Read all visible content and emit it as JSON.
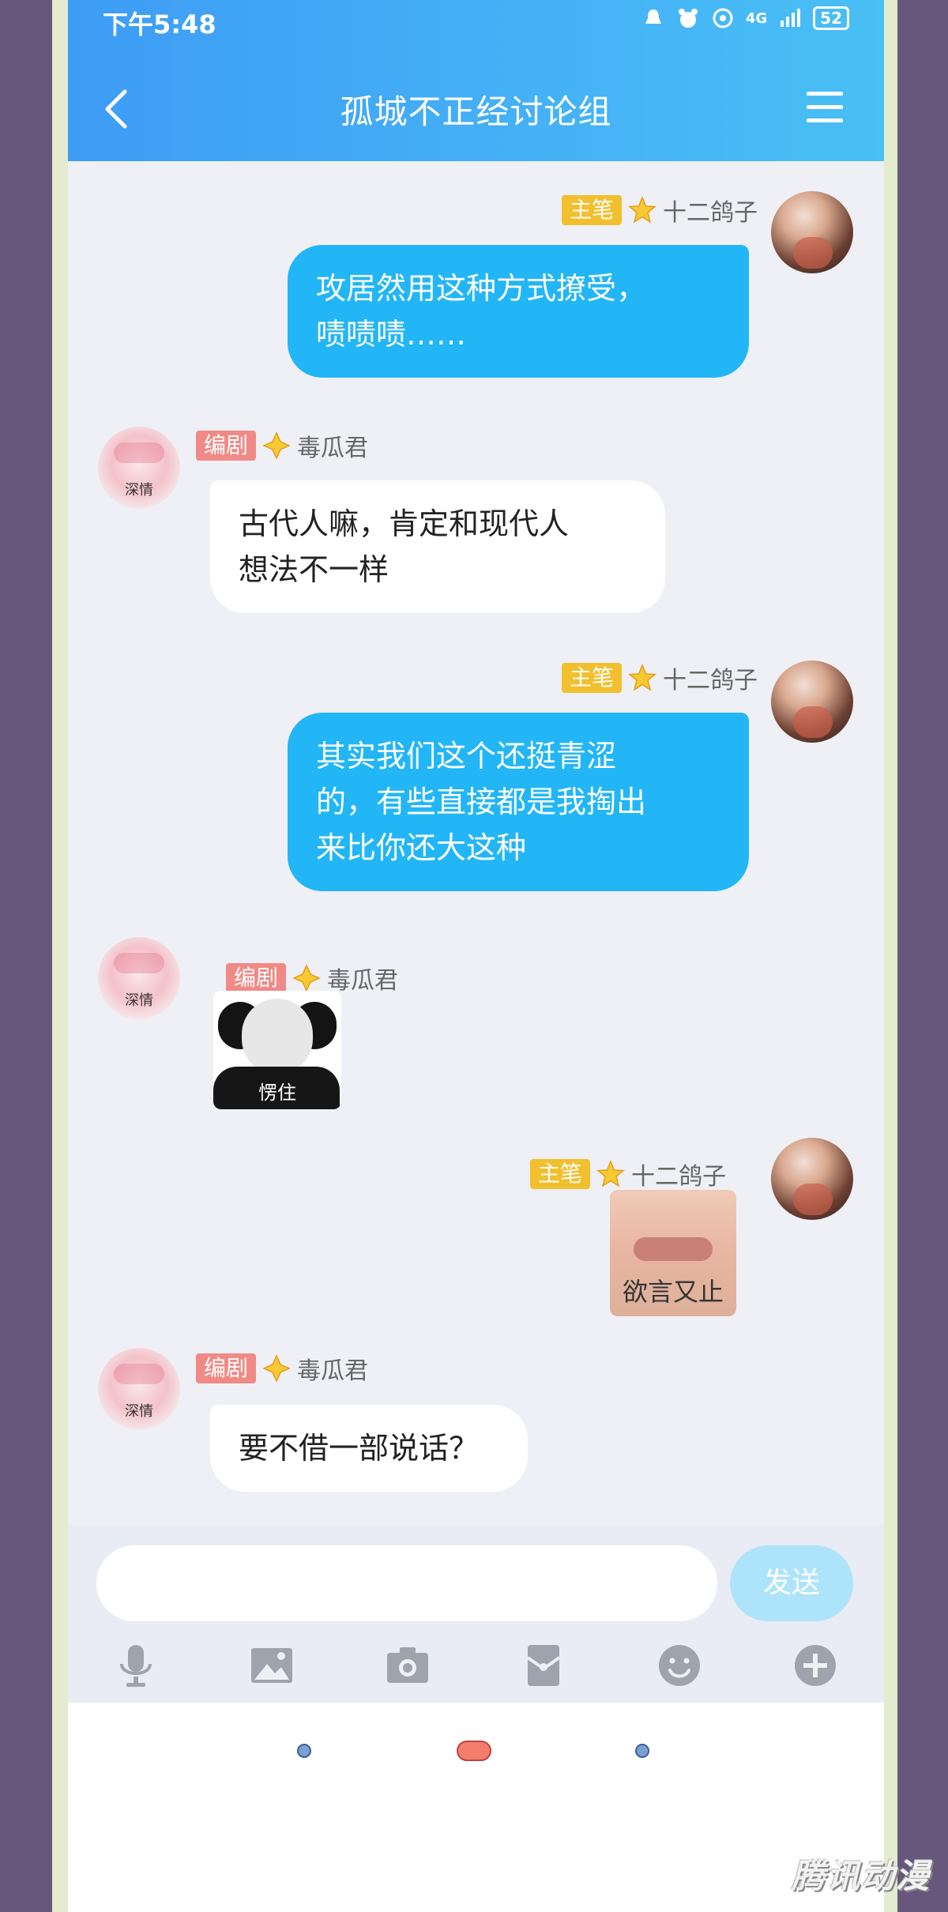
{
  "status": {
    "time": "下午5:48",
    "network": "4G",
    "battery": "52"
  },
  "header": {
    "title": "孤城不正经讨论组"
  },
  "messages": [
    {
      "side": "right",
      "role": "主笔",
      "name": "十二鸽子",
      "text_lines": [
        "攻居然用这种方式撩受，",
        "啧啧啧……"
      ]
    },
    {
      "side": "left",
      "role": "编剧",
      "name": "毒瓜君",
      "avatar_text": "深情",
      "text_lines": [
        "古代人嘛，肯定和现代人",
        "想法不一样"
      ]
    },
    {
      "side": "right",
      "role": "主笔",
      "name": "十二鸽子",
      "text_lines": [
        "其实我们这个还挺青涩",
        "的，有些直接都是我掏出",
        "来比你还大这种"
      ]
    },
    {
      "side": "left",
      "role": "编剧",
      "name": "毒瓜君",
      "avatar_text": "深情",
      "sticker_text": "愣住"
    },
    {
      "side": "right",
      "role": "主笔",
      "name": "十二鸽子",
      "sticker_text": "欲言又止"
    },
    {
      "side": "left",
      "role": "编剧",
      "name": "毒瓜君",
      "avatar_text": "深情",
      "text_lines": [
        "要不借一部说话？"
      ]
    }
  ],
  "input": {
    "placeholder": "",
    "send_label": "发送"
  },
  "toolbar": [
    "microphone-icon",
    "image-icon",
    "camera-icon",
    "red-packet-icon",
    "emoji-icon",
    "plus-icon"
  ],
  "watermark": "腾讯动漫",
  "colors": {
    "header": "#45b2f6",
    "bubble_right": "#22b6f6",
    "badge_main": "#f2bf2e",
    "badge_writer": "#ef8a86",
    "send_disabled": "#aee4fb"
  }
}
